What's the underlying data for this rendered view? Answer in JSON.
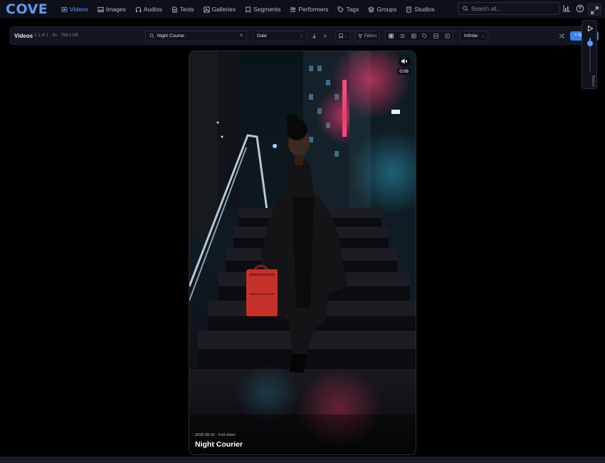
{
  "app": {
    "logo": "COVE"
  },
  "nav": {
    "items": [
      {
        "label": "Videos",
        "icon": "video-icon",
        "active": true
      },
      {
        "label": "Images",
        "icon": "image-icon",
        "active": false
      },
      {
        "label": "Audios",
        "icon": "headphones-icon",
        "active": false
      },
      {
        "label": "Texts",
        "icon": "document-icon",
        "active": false
      },
      {
        "label": "Galleries",
        "icon": "gallery-icon",
        "active": false
      },
      {
        "label": "Segments",
        "icon": "bookmark-icon",
        "active": false
      },
      {
        "label": "Performers",
        "icon": "users-icon",
        "active": false
      },
      {
        "label": "Tags",
        "icon": "tag-icon",
        "active": false
      },
      {
        "label": "Groups",
        "icon": "layers-icon",
        "active": false
      },
      {
        "label": "Studios",
        "icon": "building-icon",
        "active": false
      }
    ],
    "search_placeholder": "Search all..."
  },
  "toolbar": {
    "title": "Videos",
    "count": "1-1 of 1 · 8s · 794.2 KB",
    "search_value": "Night Courier",
    "sort_value": "Date",
    "filters_label": "Filters",
    "display_value": "Infinite",
    "new_label": "+ New"
  },
  "card": {
    "duration": "0:08",
    "meta": "2026-08-30 · Full video",
    "title": "Night Courier"
  },
  "zoom": {
    "label": "Bottom",
    "level": 0.8
  },
  "colors": {
    "accent": "#3b82f6",
    "logo": "#5e9cf5",
    "background": "#000000",
    "nav": "#0d1017"
  }
}
